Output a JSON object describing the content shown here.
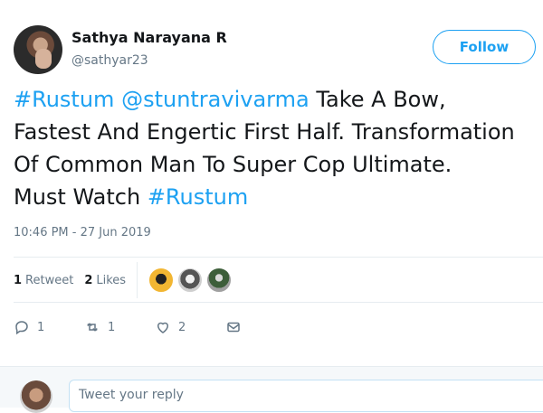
{
  "author": {
    "name": "Sathya Narayana R",
    "handle": "@sathyar23"
  },
  "follow_button": {
    "label": "Follow"
  },
  "tweet": {
    "lines": [
      [
        {
          "text": "#Rustum",
          "link": true
        },
        {
          "text": " ",
          "link": false
        },
        {
          "text": "@stuntravivarma",
          "link": true
        },
        {
          "text": " Take A Bow,",
          "link": false
        }
      ],
      [
        {
          "text": "Fastest And Engertic First Half. Transformation",
          "link": false
        }
      ],
      [
        {
          "text": "Of Common Man To Super Cop Ultimate.",
          "link": false
        }
      ],
      [
        {
          "text": "Must Watch ",
          "link": false
        },
        {
          "text": "#Rustum",
          "link": true
        }
      ]
    ],
    "timestamp": "10:46 PM - 27 Jun 2019"
  },
  "stats": {
    "retweets_count": "1",
    "retweets_label": "Retweet",
    "likes_count": "2",
    "likes_label": "Likes",
    "likers": [
      "liker-1",
      "liker-2",
      "liker-3"
    ]
  },
  "actions": {
    "reply_count": "1",
    "retweet_count": "1",
    "like_count": "2"
  },
  "reply_box": {
    "placeholder": "Tweet your reply"
  },
  "colors": {
    "accent": "#1da1f2",
    "text": "#14171a",
    "muted": "#657786",
    "divider": "#e6ecf0"
  },
  "icons": [
    "reply-icon",
    "retweet-icon",
    "like-icon",
    "dm-icon"
  ]
}
